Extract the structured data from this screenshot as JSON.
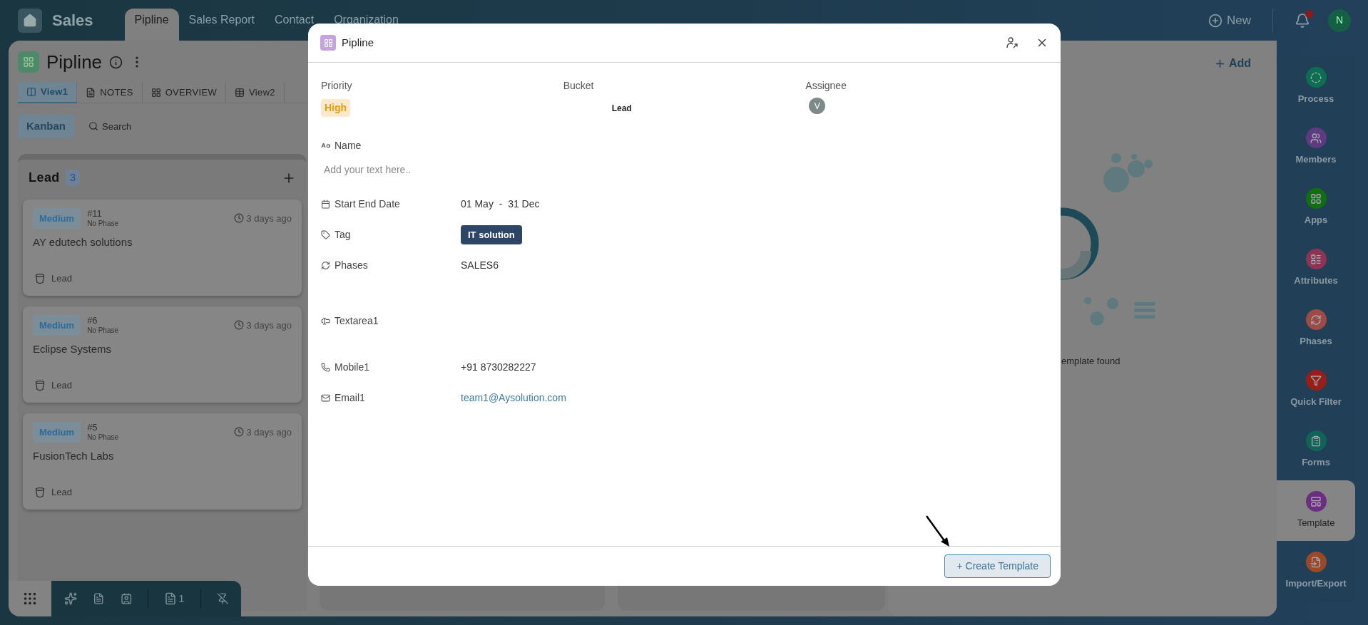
{
  "app": {
    "title": "Sales",
    "new_label": "New",
    "avatar": "N",
    "has_notification": true
  },
  "top_tabs": [
    {
      "label": "Pipline",
      "selected": true
    },
    {
      "label": "Sales Report",
      "selected": false
    },
    {
      "label": "Contact",
      "selected": false
    },
    {
      "label": "Organization",
      "selected": false
    }
  ],
  "page": {
    "title": "Pipline",
    "add_label": "Add",
    "mode": "Kanban",
    "search_label": "Search"
  },
  "views": [
    {
      "label": "View1",
      "selected": true
    },
    {
      "label": "NOTES",
      "selected": false
    },
    {
      "label": "OVERVIEW",
      "selected": false
    },
    {
      "label": "View2",
      "selected": false
    }
  ],
  "columns": [
    {
      "title": "Lead",
      "count": "3",
      "cards": [
        {
          "priority": "Medium",
          "number": "#11",
          "phase": "No Phase",
          "time": "3 days ago",
          "name": "AY edutech solutions",
          "bucket": "Lead"
        },
        {
          "priority": "Medium",
          "number": "#6",
          "phase": "No Phase",
          "time": "3 days ago",
          "name": "Eclipse Systems",
          "bucket": "Lead"
        },
        {
          "priority": "Medium",
          "number": "#5",
          "phase": "No Phase",
          "time": "3 days ago",
          "name": "FusionTech Labs",
          "bucket": "Lead"
        }
      ]
    }
  ],
  "bottom_toolbar": {
    "doc_count": "1"
  },
  "templates_panel": {
    "empty_text": "emplate found"
  },
  "sidebar": {
    "items": [
      {
        "label": "Process",
        "color": "#0e6e52",
        "selected": false
      },
      {
        "label": "Members",
        "color": "#5e3a80",
        "selected": false
      },
      {
        "label": "Apps",
        "color": "#126e12",
        "selected": false
      },
      {
        "label": "Attributes",
        "color": "#8a3552",
        "selected": false
      },
      {
        "label": "Phases",
        "color": "#9c4c45",
        "selected": false
      },
      {
        "label": "Quick Filter",
        "color": "#961f1a",
        "selected": false
      },
      {
        "label": "Forms",
        "color": "#0e6456",
        "selected": false
      },
      {
        "label": "Template",
        "color": "#6b2f80",
        "selected": true
      },
      {
        "label": "Import/Export",
        "color": "#9a4828",
        "selected": false
      }
    ]
  },
  "modal": {
    "title": "Pipline",
    "priority": {
      "label": "Priority",
      "value": "High"
    },
    "bucket": {
      "label": "Bucket",
      "value": "Lead"
    },
    "assignee": {
      "label": "Assignee",
      "initial": "V"
    },
    "fields": [
      {
        "kind": "title",
        "label": "Name",
        "placeholder": "Add your text here.."
      },
      {
        "kind": "date",
        "label": "Start End Date",
        "value": "01 May  -  31 Dec"
      },
      {
        "kind": "tag",
        "label": "Tag",
        "value": "IT solution"
      },
      {
        "kind": "phase",
        "label": "Phases",
        "value": "SALES6"
      },
      {
        "kind": "textarea",
        "label": "Textarea1"
      },
      {
        "kind": "phone",
        "label": "Mobile1",
        "value": "+91 8730282227"
      },
      {
        "kind": "email",
        "label": "Email1",
        "value": "team1@Aysolution.com"
      }
    ],
    "create_button": "+ Create Template"
  }
}
